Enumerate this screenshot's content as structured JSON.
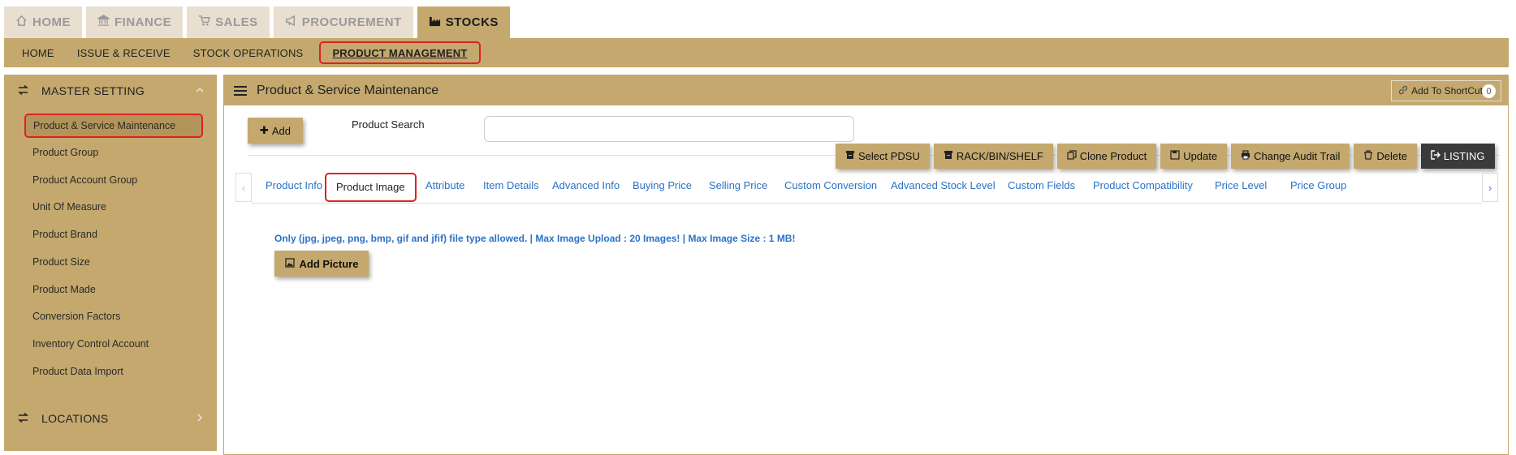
{
  "top_tabs": [
    {
      "label": "HOME",
      "icon": "home-icon"
    },
    {
      "label": "FINANCE",
      "icon": "bank-icon"
    },
    {
      "label": "SALES",
      "icon": "cart-icon"
    },
    {
      "label": "PROCUREMENT",
      "icon": "megaphone-icon"
    },
    {
      "label": "STOCKS",
      "icon": "industry-icon",
      "active": true
    }
  ],
  "sub_nav": [
    {
      "label": "HOME"
    },
    {
      "label": "ISSUE & RECEIVE"
    },
    {
      "label": "STOCK OPERATIONS"
    },
    {
      "label": "PRODUCT MANAGEMENT",
      "active": true
    }
  ],
  "sidebar": {
    "master_setting": "MASTER SETTING",
    "items": [
      {
        "label": "Product & Service Maintenance",
        "active": true
      },
      {
        "label": "Product Group"
      },
      {
        "label": "Product Account Group"
      },
      {
        "label": "Unit Of Measure"
      },
      {
        "label": "Product Brand"
      },
      {
        "label": "Product Size"
      },
      {
        "label": "Product Made"
      },
      {
        "label": "Conversion Factors"
      },
      {
        "label": "Inventory Control Account"
      },
      {
        "label": "Product Data Import"
      }
    ],
    "locations": "LOCATIONS"
  },
  "main": {
    "title": "Product & Service Maintenance",
    "shortcut_label": "Add To ShortCut",
    "shortcut_count": "0",
    "add_label": "Add",
    "search_label": "Product Search",
    "search_value": "",
    "actions": [
      {
        "label": "Select PDSU",
        "icon": "archive-icon"
      },
      {
        "label": "RACK/BIN/SHELF",
        "icon": "archive-icon"
      },
      {
        "label": "Clone Product",
        "icon": "copy-icon"
      },
      {
        "label": "Update",
        "icon": "save-icon"
      },
      {
        "label": "Change Audit Trail",
        "icon": "print-icon"
      },
      {
        "label": "Delete",
        "icon": "trash-icon"
      },
      {
        "label": "LISTING",
        "icon": "sign-out-icon"
      }
    ],
    "tabs": [
      {
        "label": "Product Info"
      },
      {
        "label": "Product Image",
        "active": true
      },
      {
        "label": "Attribute"
      },
      {
        "label": "Item Details"
      },
      {
        "label": "Advanced Info"
      },
      {
        "label": "Buying Price"
      },
      {
        "label": "Selling Price"
      },
      {
        "label": "Custom Conversion"
      },
      {
        "label": "Advanced Stock Level"
      },
      {
        "label": "Custom Fields"
      },
      {
        "label": "Product Compatibility"
      },
      {
        "label": "Price Level"
      },
      {
        "label": "Price Group"
      }
    ],
    "notice": "Only (jpg, jpeg, png, bmp, gif and jfif) file type allowed. | Max Image Upload : 20 Images! | Max Image Size : 1 MB!",
    "add_picture_label": "Add Picture"
  },
  "colors": {
    "accent": "#c4a86e",
    "accent_light": "#e8dfd0",
    "highlight": "#dd2222",
    "link": "#2b72c8",
    "dark_button": "#3a3a3a"
  }
}
